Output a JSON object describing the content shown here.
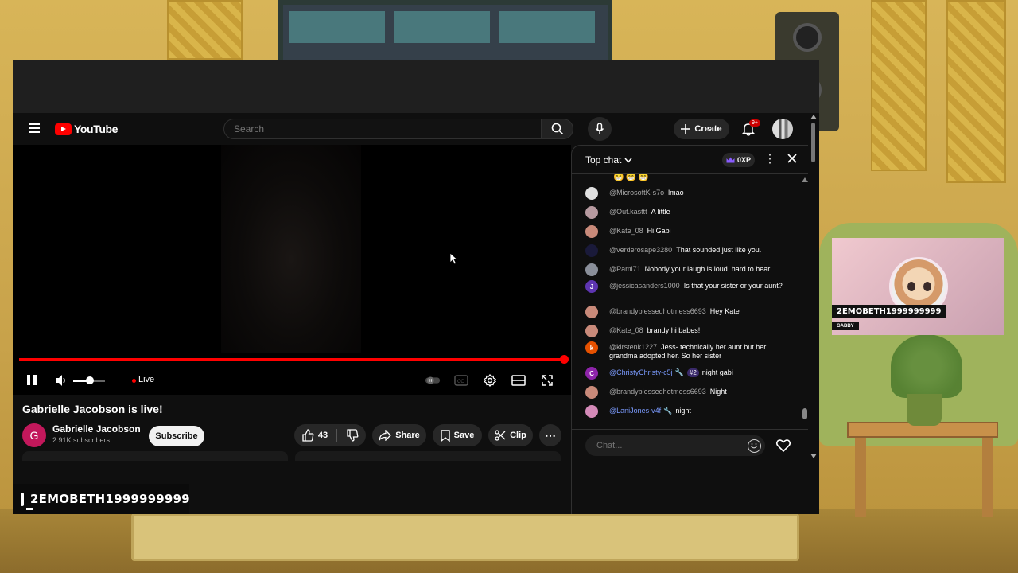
{
  "stream_overlay": {
    "streamer_name": "2EMOBETH1999999999",
    "cam_name": "2EMOBETH1999999999",
    "cam_tag": "GABBY"
  },
  "masthead": {
    "logo_text": "YouTube",
    "search_placeholder": "Search",
    "create_label": "Create",
    "notification_count": "9+"
  },
  "player": {
    "live_label": "Live",
    "progress_fraction": 1.0,
    "volume_fraction": 0.5
  },
  "video": {
    "title": "Gabrielle Jacobson is live!",
    "channel_initial": "G",
    "channel_name": "Gabrielle Jacobson",
    "subscribers": "2.91K subscribers",
    "subscribe_label": "Subscribe",
    "like_count": "43",
    "share_label": "Share",
    "save_label": "Save",
    "clip_label": "Clip"
  },
  "chat": {
    "mode_label": "Top chat",
    "xp_label": "0XP",
    "input_placeholder": "Chat...",
    "messages": [
      {
        "author": "@MicrosoftK-s7o",
        "text": "lmao",
        "avatar_color": "#e0e0e0",
        "initial": ""
      },
      {
        "author": "@Out.kasttt",
        "text": "A little",
        "avatar_color": "#b79aa0",
        "initial": ""
      },
      {
        "author": "@Kate_08",
        "text": "Hi Gabi",
        "avatar_color": "#c98a7a",
        "initial": ""
      },
      {
        "author": "@verderosape3280",
        "text": "That sounded just like you.",
        "avatar_color": "#1a1a3a",
        "initial": ""
      },
      {
        "author": "@Pami71",
        "text": "Nobody your laugh is loud. hard to hear",
        "avatar_color": "#8a8f9a",
        "initial": ""
      },
      {
        "author": "@jessicasanders1000",
        "text": "Is that your sister or your aunt?",
        "avatar_color": "#5e35b1",
        "initial": "J"
      },
      {
        "author": "@brandyblessedhotmess6693",
        "text": "Hey Kate",
        "avatar_color": "#c98a7a",
        "initial": ""
      },
      {
        "author": "@Kate_08",
        "text": "brandy hi babes!",
        "avatar_color": "#c98a7a",
        "initial": ""
      },
      {
        "author": "@kirstenk1227",
        "text": "Jess- technically her aunt but her grandma adopted her. So her sister",
        "avatar_color": "#e65100",
        "initial": "k"
      },
      {
        "author": "@ChristyChristy-c5j",
        "rank": "#2",
        "text": "night gabi",
        "avatar_color": "#8e24aa",
        "initial": "C",
        "member": true
      },
      {
        "author": "@brandyblessedhotmess6693",
        "text": "Night",
        "avatar_color": "#c98a7a",
        "initial": ""
      },
      {
        "author": "@LaniJones-v4f",
        "text": "night",
        "avatar_color": "#d48ab8",
        "initial": "",
        "member": true
      }
    ]
  }
}
